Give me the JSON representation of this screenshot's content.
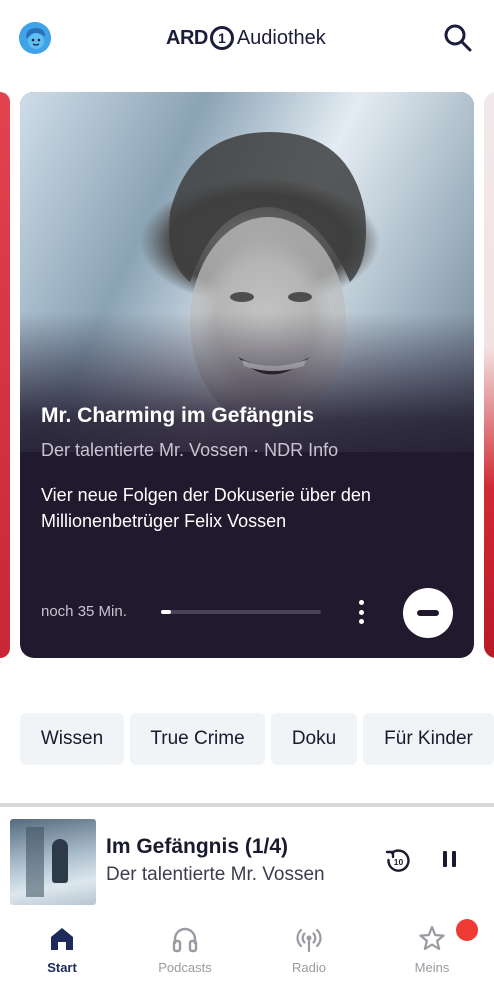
{
  "header": {
    "logo_ard": "ARD",
    "logo_one": "1",
    "logo_text": "Audiothek",
    "avatar_icon": "kid-face-avatar-icon",
    "search_icon": "search-icon"
  },
  "hero": {
    "title": "Mr. Charming im Gefängnis",
    "subtitle": "Der talentierte Mr. Vossen · NDR Info",
    "description": "Vier neue Folgen der Dokuserie über den Millionenbetrüger Felix Vossen",
    "remaining": "noch 35 Min.",
    "progress_fraction": 0.06,
    "more_icon": "more-vertical-icon",
    "play_icon": "stop-minus-icon"
  },
  "chips": [
    {
      "label": "Wissen"
    },
    {
      "label": "True Crime"
    },
    {
      "label": "Doku"
    },
    {
      "label": "Für Kinder"
    }
  ],
  "mini_player": {
    "title": "Im Gefängnis (1/4)",
    "subtitle": "Der talentierte Mr. Vossen",
    "rewind_label": "10",
    "rewind_icon": "rewind-10-icon",
    "pause_icon": "pause-icon"
  },
  "nav": {
    "items": [
      {
        "label": "Start",
        "icon": "home-icon",
        "active": true
      },
      {
        "label": "Podcasts",
        "icon": "headphones-icon",
        "active": false
      },
      {
        "label": "Radio",
        "icon": "radio-broadcast-icon",
        "active": false
      },
      {
        "label": "Meins",
        "icon": "star-icon",
        "active": false
      }
    ]
  },
  "colors": {
    "hero_background": "#211a2e",
    "brand_dark": "#1c1c3c",
    "active_nav": "#1c2b5a",
    "badge": "#ef3b33"
  }
}
